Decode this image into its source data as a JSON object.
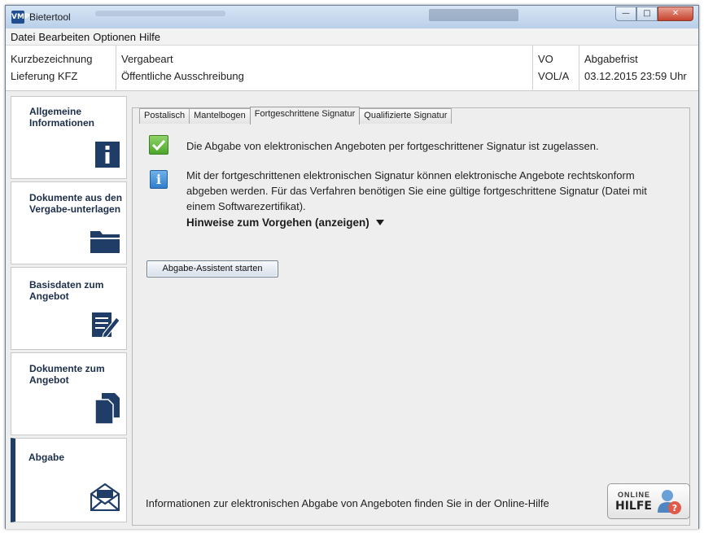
{
  "window": {
    "title": "Bietertool",
    "app_icon_text": "VMP"
  },
  "menu": [
    "Datei",
    "Bearbeiten",
    "Optionen",
    "Hilfe"
  ],
  "info_header": {
    "kurzbezeichnung_label": "Kurzbezeichnung",
    "kurzbezeichnung_value": "Lieferung KFZ",
    "vergabeart_label": "Vergabeart",
    "vergabeart_value": "Öffentliche Ausschreibung",
    "vo_label": "VO",
    "vo_value": "VOL/A",
    "abgabefrist_label": "Abgabefrist",
    "abgabefrist_value": "03.12.2015 23:59 Uhr"
  },
  "sidebar": {
    "items": [
      {
        "label": "Allgemeine Informationen",
        "icon": "info-icon"
      },
      {
        "label": "Dokumente aus den Vergabe-unterlagen",
        "icon": "folder-icon"
      },
      {
        "label": "Basisdaten zum Angebot",
        "icon": "edit-form-icon"
      },
      {
        "label": "Dokumente zum Angebot",
        "icon": "documents-icon"
      },
      {
        "label": "Abgabe",
        "icon": "envelope-icon",
        "active": true
      }
    ]
  },
  "tabs": [
    {
      "label": "Postalisch"
    },
    {
      "label": "Mantelbogen"
    },
    {
      "label": "Fortgeschrittene Signatur",
      "active": true
    },
    {
      "label": "Qualifizierte Signatur"
    }
  ],
  "main": {
    "ok_message": "Die Abgabe von elektronischen Angeboten per fortgeschrittener Signatur ist zugelassen.",
    "info_message_line1": "Mit der fortgeschrittenen elektronischen Signatur können elektronische Angebote rechtskonform",
    "info_message_line2": "abgeben werden. Für das Verfahren benötigen Sie eine gültige fortgeschrittene Signatur (Datei mit",
    "info_message_line3": "einem Softwarezertifikat).",
    "hint_link": "Hinweise zum Vorgehen (anzeigen)",
    "assistant_button": "Abgabe-Assistent starten",
    "footer_text": "Informationen zur elektronischen Abgabe von Angeboten finden Sie in der Online-Hilfe",
    "help_button_line1": "ONLINE",
    "help_button_line2": "HILFE"
  },
  "colors": {
    "nav_label": "#1c2e4a",
    "nav_icon": "#1f3d66",
    "ok_green": "#4ea62b",
    "info_blue": "#2f7ecb"
  }
}
